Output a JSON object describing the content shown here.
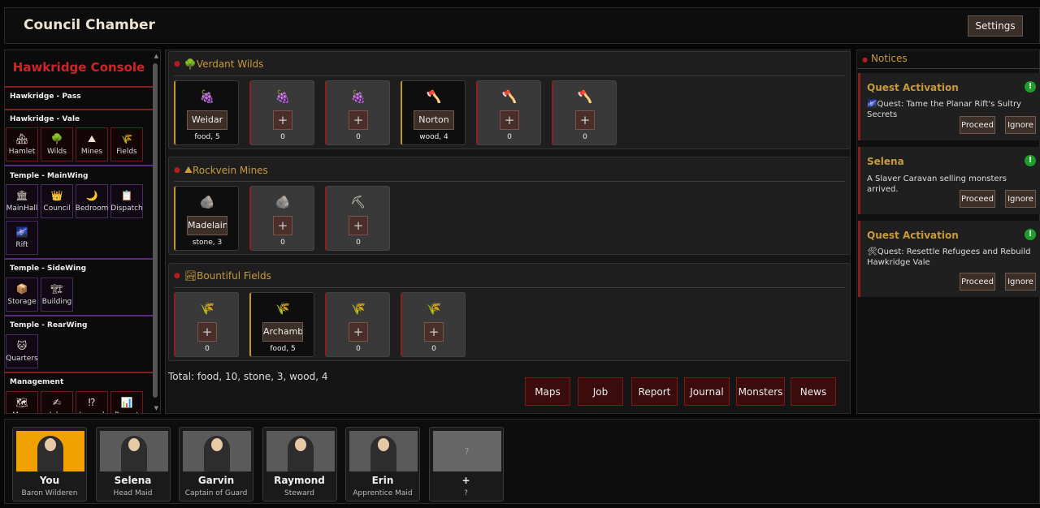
{
  "header": {
    "title": "Council Chamber",
    "settings_label": "Settings"
  },
  "sidebar": {
    "title": "Hawkridge Console",
    "sections": {
      "pass": "Hawkridge - Pass",
      "vale": "Hawkridge - Vale",
      "mainwing": "Temple - MainWing",
      "sidewing": "Temple - SideWing",
      "rearwing": "Temple - RearWing",
      "management": "Management"
    },
    "vale_buttons": [
      {
        "label": "Hamlet",
        "icon": "🏘"
      },
      {
        "label": "Wilds",
        "icon": "🌳"
      },
      {
        "label": "Mines",
        "icon": "⛰"
      },
      {
        "label": "Fields",
        "icon": "🌾"
      }
    ],
    "mainwing_buttons": [
      {
        "label": "MainHall",
        "icon": "🏛"
      },
      {
        "label": "Council",
        "icon": "👑"
      },
      {
        "label": "Bedroom",
        "icon": "🌙"
      },
      {
        "label": "Dispatch",
        "icon": "📋"
      },
      {
        "label": "Rift",
        "icon": "🌌"
      }
    ],
    "sidewing_buttons": [
      {
        "label": "Storage",
        "icon": "📦"
      },
      {
        "label": "Building",
        "icon": "🏗"
      }
    ],
    "rearwing_buttons": [
      {
        "label": "Quarters",
        "icon": "🐱"
      }
    ],
    "management_buttons": [
      {
        "label": "Maps",
        "icon": "🗺"
      },
      {
        "label": "Jobs",
        "icon": "✍"
      },
      {
        "label": "Journal",
        "icon": "⁉"
      },
      {
        "label": "Report",
        "icon": "📊"
      }
    ]
  },
  "zones": [
    {
      "title": "Verdant Wilds",
      "icon": "🌳",
      "slots": [
        {
          "icon": "🍇",
          "worker": "Weidar",
          "count": "food, 5"
        },
        {
          "icon": "🍇",
          "worker": null,
          "count": "0"
        },
        {
          "icon": "🍇",
          "worker": null,
          "count": "0"
        },
        {
          "icon": "🪓",
          "worker": "Norton",
          "count": "wood, 4"
        },
        {
          "icon": "🪓",
          "worker": null,
          "count": "0"
        },
        {
          "icon": "🪓",
          "worker": null,
          "count": "0"
        }
      ]
    },
    {
      "title": "Rockvein Mines",
      "icon": "⛰",
      "slots": [
        {
          "icon": "🪨",
          "worker": "Madelaine",
          "count": "stone, 3"
        },
        {
          "icon": "🪨",
          "worker": null,
          "count": "0"
        },
        {
          "icon": "⛏",
          "worker": null,
          "count": "0"
        }
      ]
    },
    {
      "title": "Bountiful Fields",
      "icon": "🏞",
      "slots": [
        {
          "icon": "🌾",
          "worker": null,
          "count": "0"
        },
        {
          "icon": "🌾",
          "worker": "Archambault",
          "count": "food, 5"
        },
        {
          "icon": "🌾",
          "worker": null,
          "count": "0"
        },
        {
          "icon": "🌾",
          "worker": null,
          "count": "0"
        }
      ]
    }
  ],
  "plus_symbol": "+",
  "total": "Total: food, 10, stone, 3, wood, 4",
  "actions": [
    "Maps",
    "Job",
    "Report",
    "Journal",
    "Monsters",
    "News"
  ],
  "notices": {
    "title": "Notices",
    "items": [
      {
        "title": "Quest Activation",
        "text": "🌌Quest: Tame the Planar Rift's Sultry Secrets",
        "proceed": "Proceed",
        "ignore": "Ignore"
      },
      {
        "title": "Selena",
        "text": "A Slaver Caravan selling monsters arrived.",
        "proceed": "Proceed",
        "ignore": "Ignore"
      },
      {
        "title": "Quest Activation",
        "text": "🛠Quest: Resettle Refugees and Rebuild Hawkridge Vale",
        "proceed": "Proceed",
        "ignore": "Ignore"
      }
    ],
    "alert_symbol": "!"
  },
  "party": [
    {
      "name": "You",
      "role": "Baron Wilderen",
      "bg": "#f0a000"
    },
    {
      "name": "Selena",
      "role": "Head Maid",
      "bg": "#5a5a5a"
    },
    {
      "name": "Garvin",
      "role": "Captain of Guard",
      "bg": "#5a5a5a"
    },
    {
      "name": "Raymond",
      "role": "Steward",
      "bg": "#5a5a5a"
    },
    {
      "name": "Erin",
      "role": "Apprentice Maid",
      "bg": "#5a5a5a"
    },
    {
      "name": "+",
      "role": "?",
      "bg": "#666666",
      "placeholder": "?"
    }
  ]
}
